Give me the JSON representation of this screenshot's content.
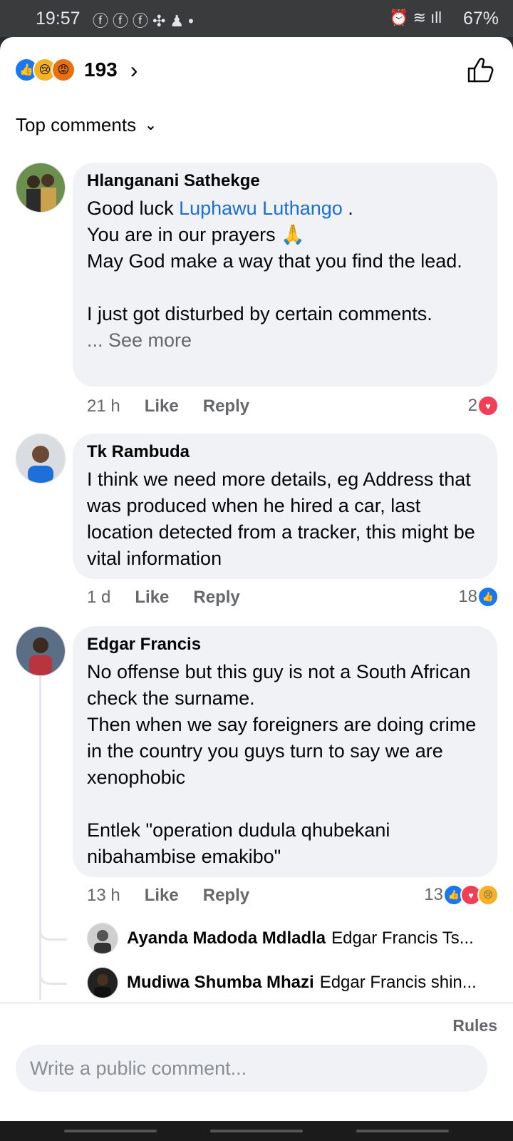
{
  "status_bar": {
    "time": "19:57",
    "battery": "67%"
  },
  "header": {
    "reaction_count": "193"
  },
  "sort": {
    "label": "Top comments"
  },
  "comments": [
    {
      "author": "Hlanganani Sathekge",
      "line1_prefix": "Good luck ",
      "mention": "Luphawu Luthango",
      "line1_suffix": " .",
      "body_rest": "You are in our prayers 🙏\nMay God make a way that you find the lead.\n\nI just got disturbed by certain comments.",
      "see_more": "... See more",
      "time": "21 h",
      "like": "Like",
      "reply": "Reply",
      "reaction_count": "2"
    },
    {
      "author": "Tk Rambuda",
      "body": "I think we need more details, eg Address that was produced when he hired a car, last location detected from a tracker, this might be vital information",
      "time": "1 d",
      "like": "Like",
      "reply": "Reply",
      "reaction_count": "18"
    },
    {
      "author": "Edgar Francis",
      "body": "No offense but this guy is not a South African check the surname.\nThen when we say foreigners are doing crime in the country you guys turn to say we are xenophobic\n\nEntlek \"operation dudula qhubekani nibahambise emakibo\"",
      "time": "13 h",
      "like": "Like",
      "reply": "Reply",
      "reaction_count": "13",
      "replies": [
        {
          "author": "Ayanda Madoda Mdladla",
          "text": "Edgar Francis Ts..."
        },
        {
          "author": "Mudiwa Shumba Mhazi",
          "text": "Edgar Francis shin..."
        }
      ]
    }
  ],
  "composer": {
    "rules": "Rules",
    "placeholder": "Write a public comment..."
  }
}
